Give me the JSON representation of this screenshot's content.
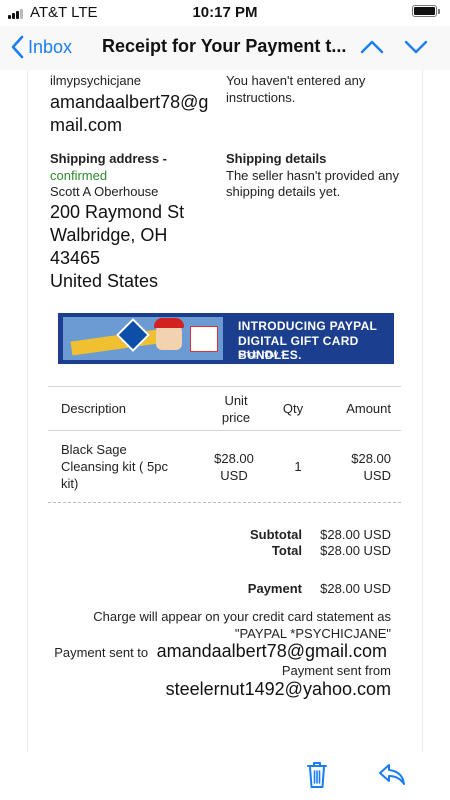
{
  "status_bar": {
    "carrier": "AT&T  LTE",
    "time": "10:17 PM"
  },
  "nav": {
    "back_label": "Inbox",
    "title": "Receipt for Your Payment t..."
  },
  "email": {
    "left_top_small": "ilmypsychicjane",
    "left_top_email": "amandaalbert78@gmail.com",
    "left_top_email_line1": "amandaalbert78@g",
    "left_top_email_line2": "mail.com",
    "instructions_line1": "You haven't entered any",
    "instructions_line2": "instructions.",
    "shipping_address_label": "Shipping address -",
    "shipping_address_status": "confirmed",
    "shipping_name": "Scott A Oberhouse",
    "address_line1": "200 Raymond St",
    "address_line2": "Walbridge, OH",
    "address_line3": "43465",
    "address_line4": "United States",
    "shipping_details_label": "Shipping details",
    "shipping_details_line1": "The seller hasn't provided any",
    "shipping_details_line2": "shipping details yet."
  },
  "banner": {
    "line1": "INTRODUCING PAYPAL",
    "line2": "DIGITAL GIFT CARD BUNDLES.",
    "cta": "Shop now >"
  },
  "table": {
    "headers": {
      "description": "Description",
      "unit_price_line1": "Unit",
      "unit_price_line2": "price",
      "qty": "Qty",
      "amount": "Amount"
    },
    "rows": [
      {
        "description_line1": "Black Sage",
        "description_line2": "Cleansing kit ( 5pc",
        "description_line3": "kit)",
        "unit_price_line1": "$28.00",
        "unit_price_line2": "USD",
        "qty": "1",
        "amount_line1": "$28.00",
        "amount_line2": "USD"
      }
    ]
  },
  "totals": {
    "subtotal_label": "Subtotal",
    "subtotal_value": "$28.00 USD",
    "total_label": "Total",
    "total_value": "$28.00 USD",
    "payment_label": "Payment",
    "payment_value": "$28.00 USD"
  },
  "footer": {
    "charge_line1": "Charge will appear on your credit card statement as",
    "charge_line2": "\"PAYPAL *PSYCHICJANE\"",
    "sent_to_label": "Payment sent to",
    "sent_to_email": "amandaalbert78@gmail.com",
    "sent_from_label": "Payment sent from",
    "sent_from_email": "steelernut1492@yahoo.com"
  },
  "toolbar": {
    "icons": [
      "trash-icon",
      "reply-icon"
    ]
  },
  "colors": {
    "accent": "#1a7ef2",
    "confirmed": "#2e8b2e",
    "banner_bg": "#1b3e8e"
  }
}
